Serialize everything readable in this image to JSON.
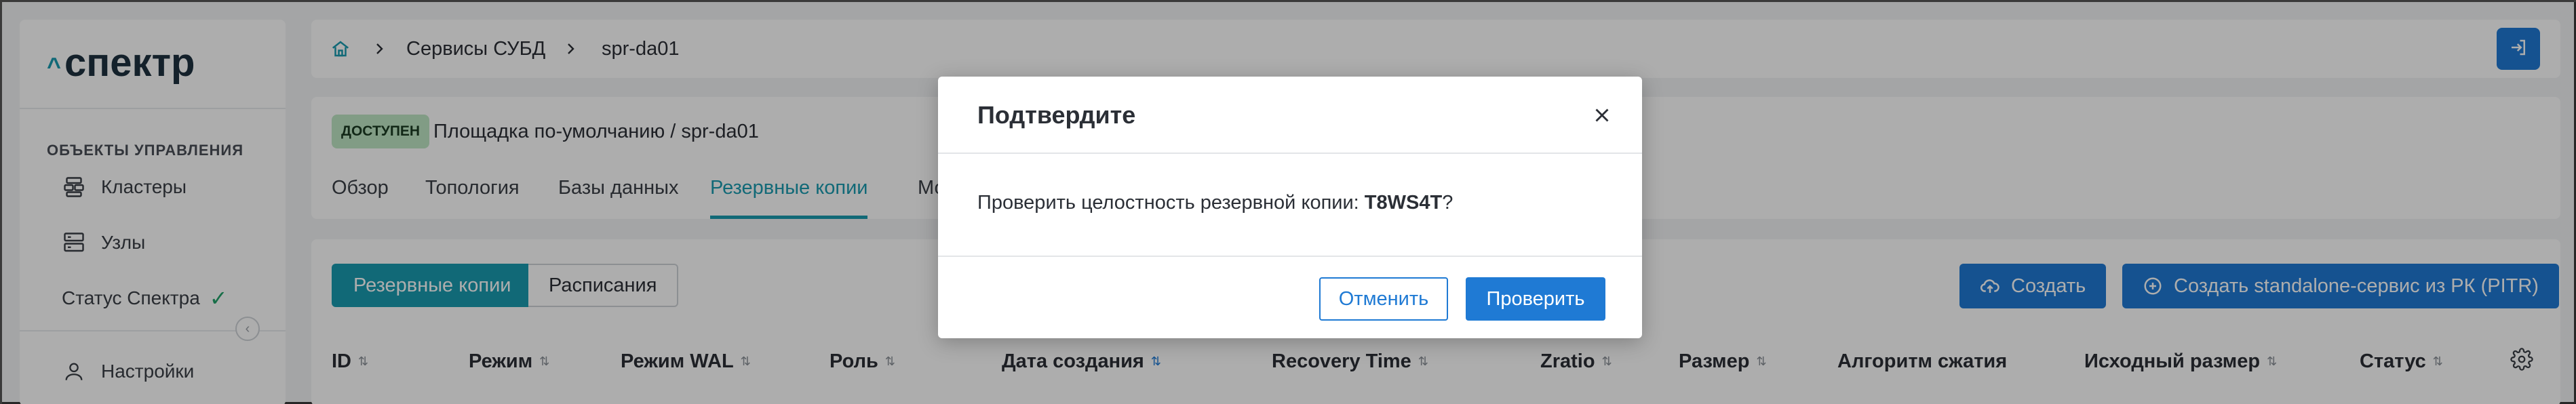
{
  "app": {
    "logo_caret": "^",
    "logo_text": "спектр"
  },
  "sidebar": {
    "section_title": "ОБЪЕКТЫ УПРАВЛЕНИЯ",
    "items": [
      {
        "label": "Кластеры",
        "icon": "layers-icon"
      },
      {
        "label": "Узлы",
        "icon": "server-icon"
      }
    ],
    "status_label": "Статус Спектра",
    "status_icon": "check-icon",
    "settings_label": "Настройки",
    "settings_icon": "user-icon",
    "collapse_icon": "chevron-left-icon"
  },
  "topbar": {
    "home_icon": "home-icon",
    "breadcrumbs": [
      "Сервисы СУБД",
      "spr-da01"
    ],
    "logout_icon": "logout-icon"
  },
  "header": {
    "status_badge": "ДОСТУПЕН",
    "path": "Площадка по-умолчанию /  spr-da01",
    "tabs": [
      {
        "label": "Обзор",
        "active": false
      },
      {
        "label": "Топология",
        "active": false
      },
      {
        "label": "Базы данных",
        "active": false
      },
      {
        "label": "Резервные копии",
        "active": true
      },
      {
        "label": "Мо",
        "active": false
      }
    ]
  },
  "content": {
    "segments": [
      {
        "label": "Резервные копии",
        "active": true
      },
      {
        "label": "Расписания",
        "active": false
      }
    ],
    "create_label": "Создать",
    "create_standalone_label": "Создать standalone-сервис из РК (PITR)",
    "columns": [
      {
        "label": "ID",
        "sortable": true
      },
      {
        "label": "Режим",
        "sortable": true
      },
      {
        "label": "Режим WAL",
        "sortable": true
      },
      {
        "label": "Роль",
        "sortable": true
      },
      {
        "label": "Дата создания",
        "sortable": true,
        "sorted": true
      },
      {
        "label": "Recovery Time",
        "sortable": true
      },
      {
        "label": "Zratio",
        "sortable": true
      },
      {
        "label": "Размер",
        "sortable": true
      },
      {
        "label": "Алгоритм сжатия",
        "sortable": false
      },
      {
        "label": "Исходный размер",
        "sortable": true
      },
      {
        "label": "Статус",
        "sortable": true
      }
    ],
    "settings_icon": "gear-icon"
  },
  "modal": {
    "title": "Подтвердите",
    "message_prefix": "Проверить целостность резервной копии: ",
    "backup_id": "T8WS4T",
    "message_suffix": "?",
    "cancel_label": "Отменить",
    "confirm_label": "Проверить",
    "close_icon": "close-icon"
  },
  "colors": {
    "accent": "#1a9bb0",
    "primary": "#1f7ad4",
    "badge_bg": "#bfe6c4",
    "success": "#22a36a"
  }
}
